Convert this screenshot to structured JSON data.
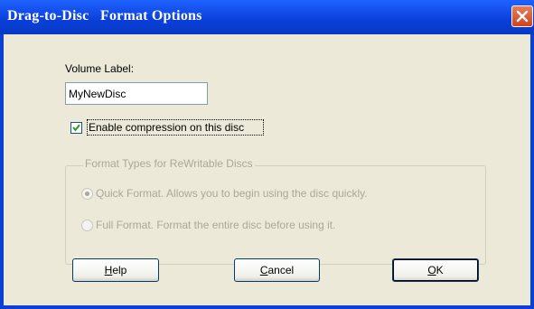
{
  "window": {
    "title": "Drag-to-Disc   Format Options",
    "close_icon": "close-icon"
  },
  "form": {
    "volume_label": "Volume Label:",
    "volume_value": "MyNewDisc",
    "compression": {
      "label": "Enable compression on this disc",
      "checked": true
    }
  },
  "format_group": {
    "legend": "Format Types for ReWritable Discs",
    "options": [
      {
        "label": "Quick Format.  Allows you to begin using the disc quickly.",
        "selected": true,
        "enabled": false
      },
      {
        "label": "Full Format.  Format the entire disc before using it.",
        "selected": false,
        "enabled": false
      }
    ]
  },
  "buttons": {
    "help": {
      "mnemonic": "H",
      "rest": "elp"
    },
    "cancel": {
      "mnemonic": "C",
      "rest": "ancel"
    },
    "ok": {
      "mnemonic": "O",
      "rest": "K"
    }
  },
  "colors": {
    "titlebar": "#0a3fd8",
    "client": "#ece9d8",
    "disabled_text": "#aca899"
  }
}
